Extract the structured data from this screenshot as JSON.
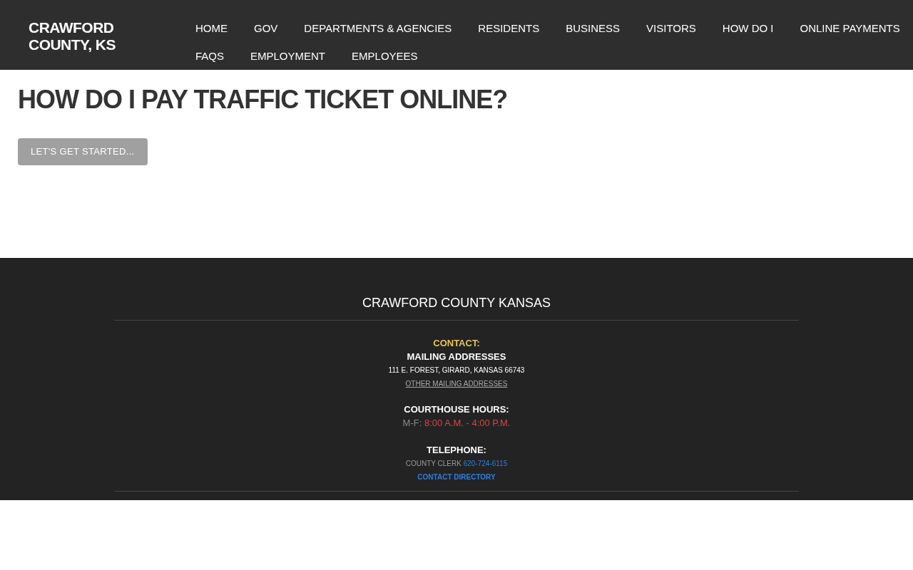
{
  "header": {
    "logo": "CRAWFORD COUNTY, KS",
    "nav": [
      "HOME",
      "GOV",
      "DEPARTMENTS & AGENCIES",
      "RESIDENTS",
      "BUSINESS",
      "VISITORS",
      "HOW DO I",
      "ONLINE PAYMENTS",
      "FAQS",
      "EMPLOYMENT",
      "EMPLOYEES"
    ]
  },
  "main": {
    "title": "HOW DO I PAY TRAFFIC TICKET ONLINE?",
    "button": "LET'S GET STARTED..."
  },
  "footer": {
    "title": "CRAWFORD COUNTY KANSAS",
    "contact_label": "CONTACT:",
    "mailing_heading": "MAILING ADDRESSES",
    "address": "111 E. FOREST, GIRARD, KANSAS 66743",
    "other_addresses_link": "OTHER MAILING ADDRESSES",
    "hours_heading": "COURTHOUSE HOURS:",
    "hours_days": "M-F:",
    "hours_time": "8:00 A.M. - 4:00 P.M.",
    "telephone_heading": "TELEPHONE:",
    "clerk_label": "COUNTY CLERK",
    "clerk_phone": "620-724-6115",
    "directory_link": "CONTACT DIRECTORY"
  }
}
